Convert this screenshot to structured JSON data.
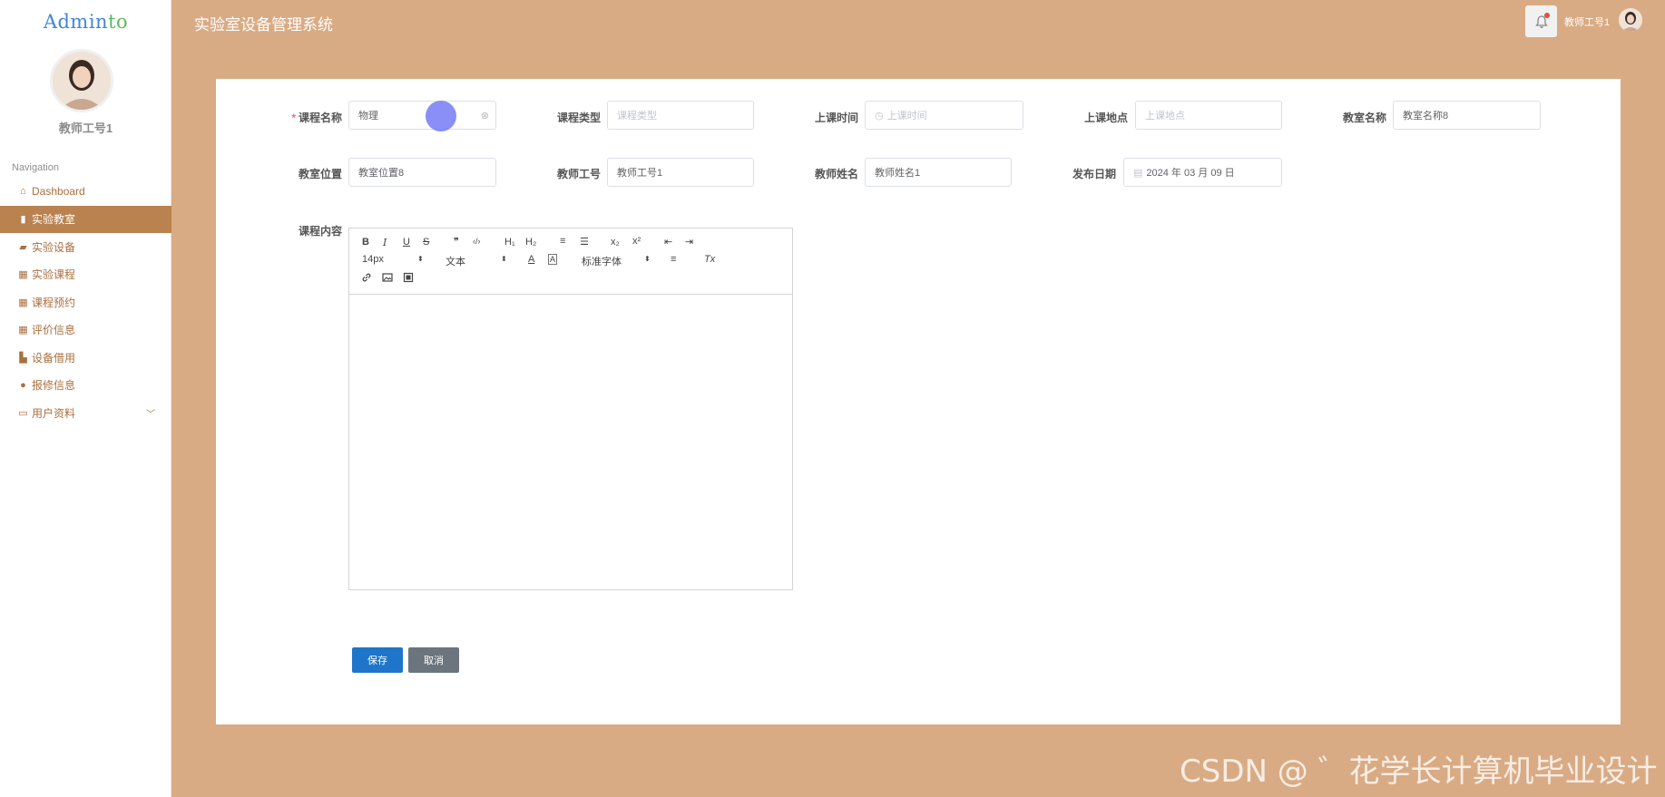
{
  "app": {
    "logo_main": "Admin",
    "logo_accent": "to",
    "title": "实验室设备管理系统"
  },
  "user": {
    "name": "教师工号1"
  },
  "sidebar": {
    "nav_title": "Navigation",
    "items": [
      {
        "label": "Dashboard",
        "icon": "home-icon"
      },
      {
        "label": "实验教室",
        "icon": "clipboard-icon",
        "active": true
      },
      {
        "label": "实验设备",
        "icon": "video-camera-icon"
      },
      {
        "label": "实验课程",
        "icon": "grid-icon"
      },
      {
        "label": "课程预约",
        "icon": "grid-icon"
      },
      {
        "label": "评价信息",
        "icon": "grid-icon"
      },
      {
        "label": "设备借用",
        "icon": "thumbs-up-icon"
      },
      {
        "label": "报修信息",
        "icon": "user-icon"
      },
      {
        "label": "用户资料",
        "icon": "credit-card-icon"
      }
    ]
  },
  "form": {
    "course_name": {
      "label": "课程名称",
      "value": "物理"
    },
    "course_type": {
      "label": "课程类型",
      "placeholder": "课程类型"
    },
    "class_time": {
      "label": "上课时间",
      "placeholder": "上课时间"
    },
    "class_location": {
      "label": "上课地点",
      "placeholder": "上课地点"
    },
    "classroom_name": {
      "label": "教室名称",
      "value": "教室名称8"
    },
    "classroom_position": {
      "label": "教室位置",
      "value": "教室位置8"
    },
    "teacher_id": {
      "label": "教师工号",
      "value": "教师工号1"
    },
    "teacher_name": {
      "label": "教师姓名",
      "value": "教师姓名1"
    },
    "publish_date": {
      "label": "发布日期",
      "value": "2024 年 03 月 09 日"
    },
    "content": {
      "label": "课程内容"
    }
  },
  "editor": {
    "toolbar": {
      "bold": "B",
      "italic": "I",
      "underline": "U",
      "strike": "S",
      "blockquote": "❞",
      "code": "‹/›",
      "h1": "H₁",
      "h2": "H₂",
      "ordered_list": "≡",
      "bullet_list": "☰",
      "subscript": "x₂",
      "superscript": "x²",
      "outdent": "⇤",
      "indent": "⇥",
      "size": "14px",
      "header": "文本",
      "color": "A",
      "background": "A",
      "font": "标准字体",
      "align": "≡",
      "clean": "Tx",
      "link": "🔗",
      "image": "▣",
      "video": "▤"
    }
  },
  "buttons": {
    "save": "保存",
    "cancel": "取消"
  },
  "watermark": "CSDN @ ゛花学长计算机毕业设计"
}
